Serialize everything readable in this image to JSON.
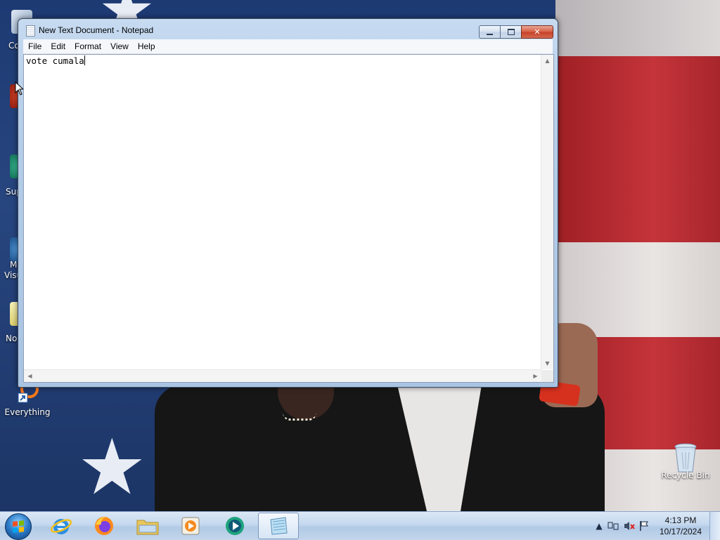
{
  "desktop": {
    "icons": [
      {
        "label": "Everything",
        "icon": "everything-icon"
      },
      {
        "label": "Recycle Bin",
        "icon": "recycle-bin-icon"
      }
    ],
    "partial_labels": [
      "Co",
      "Sup",
      "M",
      "Visu",
      "No"
    ]
  },
  "notepad": {
    "title": "New Text Document - Notepad",
    "menu": [
      "File",
      "Edit",
      "Format",
      "View",
      "Help"
    ],
    "content": "vote cumala",
    "buttons": {
      "minimize": "minimize-icon",
      "maximize": "maximize-icon",
      "close": "close-icon"
    }
  },
  "taskbar": {
    "pinned": [
      {
        "name": "internet-explorer",
        "icon": "internet-explorer-icon"
      },
      {
        "name": "firefox",
        "icon": "firefox-icon"
      },
      {
        "name": "file-explorer",
        "icon": "folder-icon"
      },
      {
        "name": "media-player",
        "icon": "media-player-icon"
      },
      {
        "name": "media-app",
        "icon": "media-app-icon"
      },
      {
        "name": "notepad",
        "icon": "notepad-icon",
        "active": true
      }
    ],
    "tray": {
      "time": "4:13 PM",
      "date": "10/17/2024"
    }
  },
  "colors": {
    "taskbar": "#c4d8ee",
    "window_frame": "#b5cde8",
    "close_button": "#c7422a"
  }
}
